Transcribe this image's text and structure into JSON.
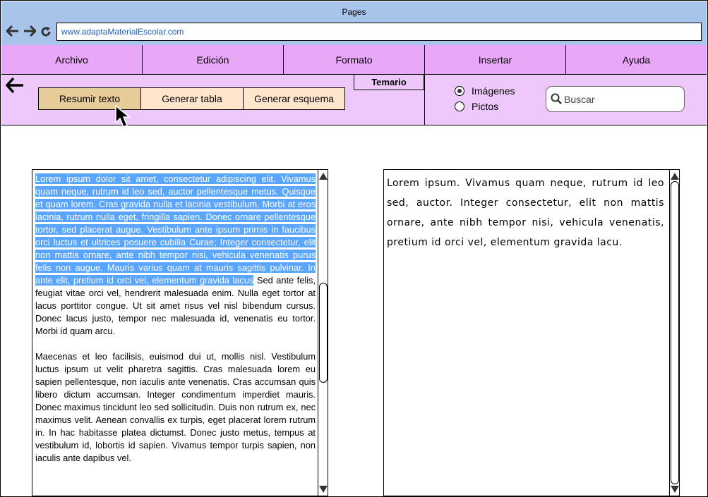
{
  "window": {
    "title": "Pages"
  },
  "browser": {
    "back_icon": "arrow-left",
    "forward_icon": "arrow-right",
    "reload_icon": "refresh",
    "url": "www.adaptaMaterialEscolar.com"
  },
  "menu": {
    "items": [
      "Archivo",
      "Edición",
      "Formato",
      "Insertar",
      "Ayuda"
    ]
  },
  "toolbar": {
    "back_icon": "arrow-left",
    "buttons": [
      {
        "label": "Resumir texto",
        "active": true
      },
      {
        "label": "Generar tabla",
        "active": false
      },
      {
        "label": "Generar esquema",
        "active": false
      }
    ],
    "temario_label": "Temario",
    "radio_options": [
      {
        "label": "Imágenes",
        "selected": true
      },
      {
        "label": "Pictos",
        "selected": false
      }
    ],
    "search_placeholder": "Buscar"
  },
  "left_pane": {
    "highlighted": "Lorem ipsum dolor sit amet, consectetur adipiscing elit. Vivamus quam neque, rutrum id leo sed, auctor pellentesque metus. Quisque et quam lorem. Cras gravida nulla et lacinia vestibulum. Morbi at eros lacinia, rutrum nulla eget, fringilla sapien. Donec ornare pellentesque tortor, sed placerat augue. Vestibulum ante ipsum primis in faucibus orci luctus et ultrices posuere cubilia Curae; Integer consectetur, elit non mattis ornare, ante nibh tempor nisi, vehicula venenatis purus felis non augue. Mauris varius quam at mauris sagittis pulvinar. In ante elit, pretium id orci vel, elementum gravida lacus",
    "rest_para1": " Sed ante felis, feugiat vitae orci vel, hendrerit malesuada enim. Nulla eget tortor at lacus porttitor congue. Ut sit amet risus vel nisl bibendum cursus. Donec lacus justo, tempor nec malesuada id, venenatis eu tortor. Morbi id quam arcu.",
    "para2": "Maecenas et leo facilisis, euismod dui ut, mollis nisl. Vestibulum luctus ipsum ut velit pharetra sagittis. Cras malesuada lorem eu sapien pellentesque, non iaculis ante venenatis. Cras accumsan quis libero dictum accumsan. Integer condimentum imperdiet mauris. Donec maximus tincidunt leo sed sollicitudin. Duis non rutrum ex, nec maximus velit. Aenean convallis ex turpis, eget placerat lorem rutrum in. In hac habitasse platea dictumst. Donec justo metus, tempus at vestibulum id, lobortis id sapien. Vivamus tempor turpis sapien, non iaculis ante dapibus vel."
  },
  "right_pane": {
    "text": "Lorem ipsum. Vivamus quam neque, rutrum id leo sed, auctor. Integer consectetur, elit non mattis ornare, ante nibh tempor nisi, vehicula venenatis, pretium id orci vel, elementum gravida lacu."
  },
  "colors": {
    "titlebar": "#a9c4eb",
    "menubar": "#e8a7f7",
    "toolbar": "#efc8fb",
    "button_active": "#e5cc99",
    "button": "#ffe6cc",
    "highlight": "#5aa6ff"
  }
}
